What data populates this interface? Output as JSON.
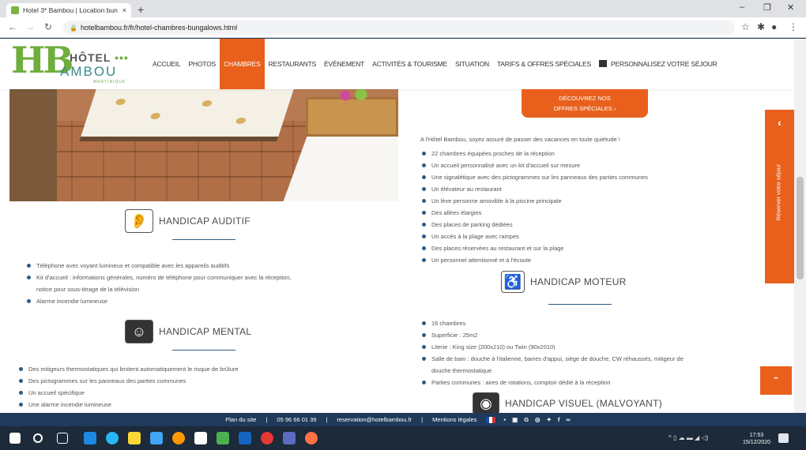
{
  "browser": {
    "tab_title": "Hotel 3* Bambou | Location bun",
    "new_tab": "+",
    "close_tab": "×",
    "url": "hotelbambou.fr/fr/hotel-chambres-bungalows.html",
    "win_min": "–",
    "win_max": "❐",
    "win_close": "✕"
  },
  "site": {
    "logo_hotel": "HÔTEL",
    "logo_bambou": "AMBOU",
    "logo_region": "MARTINIQUE",
    "menu": [
      {
        "label": "ACCUEIL"
      },
      {
        "label": "PHOTOS"
      },
      {
        "label": "CHAMBRES",
        "active": true
      },
      {
        "label": "RESTAURANTS"
      },
      {
        "label": "ÉVÉNEMENT"
      },
      {
        "label": "ACTIVITÉS & TOURISME"
      },
      {
        "label": "SITUATION"
      },
      {
        "label": "TARIFS & OFFRES SPÉCIALES"
      },
      {
        "label": "PERSONNALISEZ VOTRE SÉJOUR"
      }
    ],
    "promo_line1": "DÉCOUVREZ NOS",
    "promo_line2": "OFFRES SPÉCIALES ›"
  },
  "handicap_auditif": {
    "title": "HANDICAP AUDITIF",
    "items": [
      "Téléphone avec voyant lumineux et compatible avec les appareils auditifs",
      "Kit d'accueil : informations générales, numéro de téléphone pour communiquer avec la réception,",
      "notice pour sous-titrage de la télévision",
      "Alarme incendie lumineuse"
    ]
  },
  "handicap_mental": {
    "title": "HANDICAP MENTAL",
    "items": [
      "Des mitigeurs thermostatiques qui limitent automatiquement le risque de brûlure",
      "Des pictogrammes sur les panneaux des parties communes",
      "Un accueil spécifique",
      "Une alarme incendie lumineuse"
    ]
  },
  "general": {
    "intro": "A l'Hôtel Bambou, soyez assuré de passer des vacances en toute quiétude !",
    "items": [
      "22 chambres équipées proches de la réception",
      "Un accueil personnalisé avec un kit d'accueil sur mesure",
      "Une signalétique avec des pictogrammes sur les panneaux des parties communes",
      "Un élévateur au restaurant",
      "Un lève personne amovible à la piscine principale",
      "Des allées élargies",
      "Des places de parking dédiées",
      "Un accès à la plage avec rampes",
      "Des places réservées au restaurant et sur la plage",
      "Un personnel attentionné et à l'écoute"
    ]
  },
  "handicap_moteur": {
    "title": "HANDICAP MOTEUR",
    "items": [
      "16 chambres",
      "Superficie : 25m2",
      "Literie : King size (200x210) ou Twin (90x2010)",
      "Salle de bain : douche à l'italienne, barres d'appui, siège de douche, CW réhaussés, mitigeur de",
      "douche thermostatique",
      "Parties communes : aires de rotations, comptoir dédié à la réception"
    ]
  },
  "handicap_visuel": {
    "title": "HANDICAP VISUEL (MALVOYANT)"
  },
  "side": {
    "reserve": "Réserver votre séjour",
    "chevron": "‹",
    "up": "⌃"
  },
  "footer": {
    "plan": "Plan du site",
    "sep": "|",
    "phone": "05 96 66 01 39",
    "email": "reservation@hotelbambou.fr",
    "legal": "Mentions légales"
  },
  "taskbar": {
    "time": "17:53",
    "date": "15/12/2020",
    "colors": [
      "#1e88e5",
      "#ffffff",
      "#4caf50",
      "#29b6f6",
      "#fdd835",
      "#42a5f5",
      "#ff9800",
      "#ffffff",
      "#4caf50",
      "#1565c0",
      "#e53935",
      "#5c6bc0",
      "#ff7043"
    ]
  },
  "colors": {
    "accent": "#e8601c",
    "navy": "#1f3a5a",
    "green": "#6fae3c"
  }
}
